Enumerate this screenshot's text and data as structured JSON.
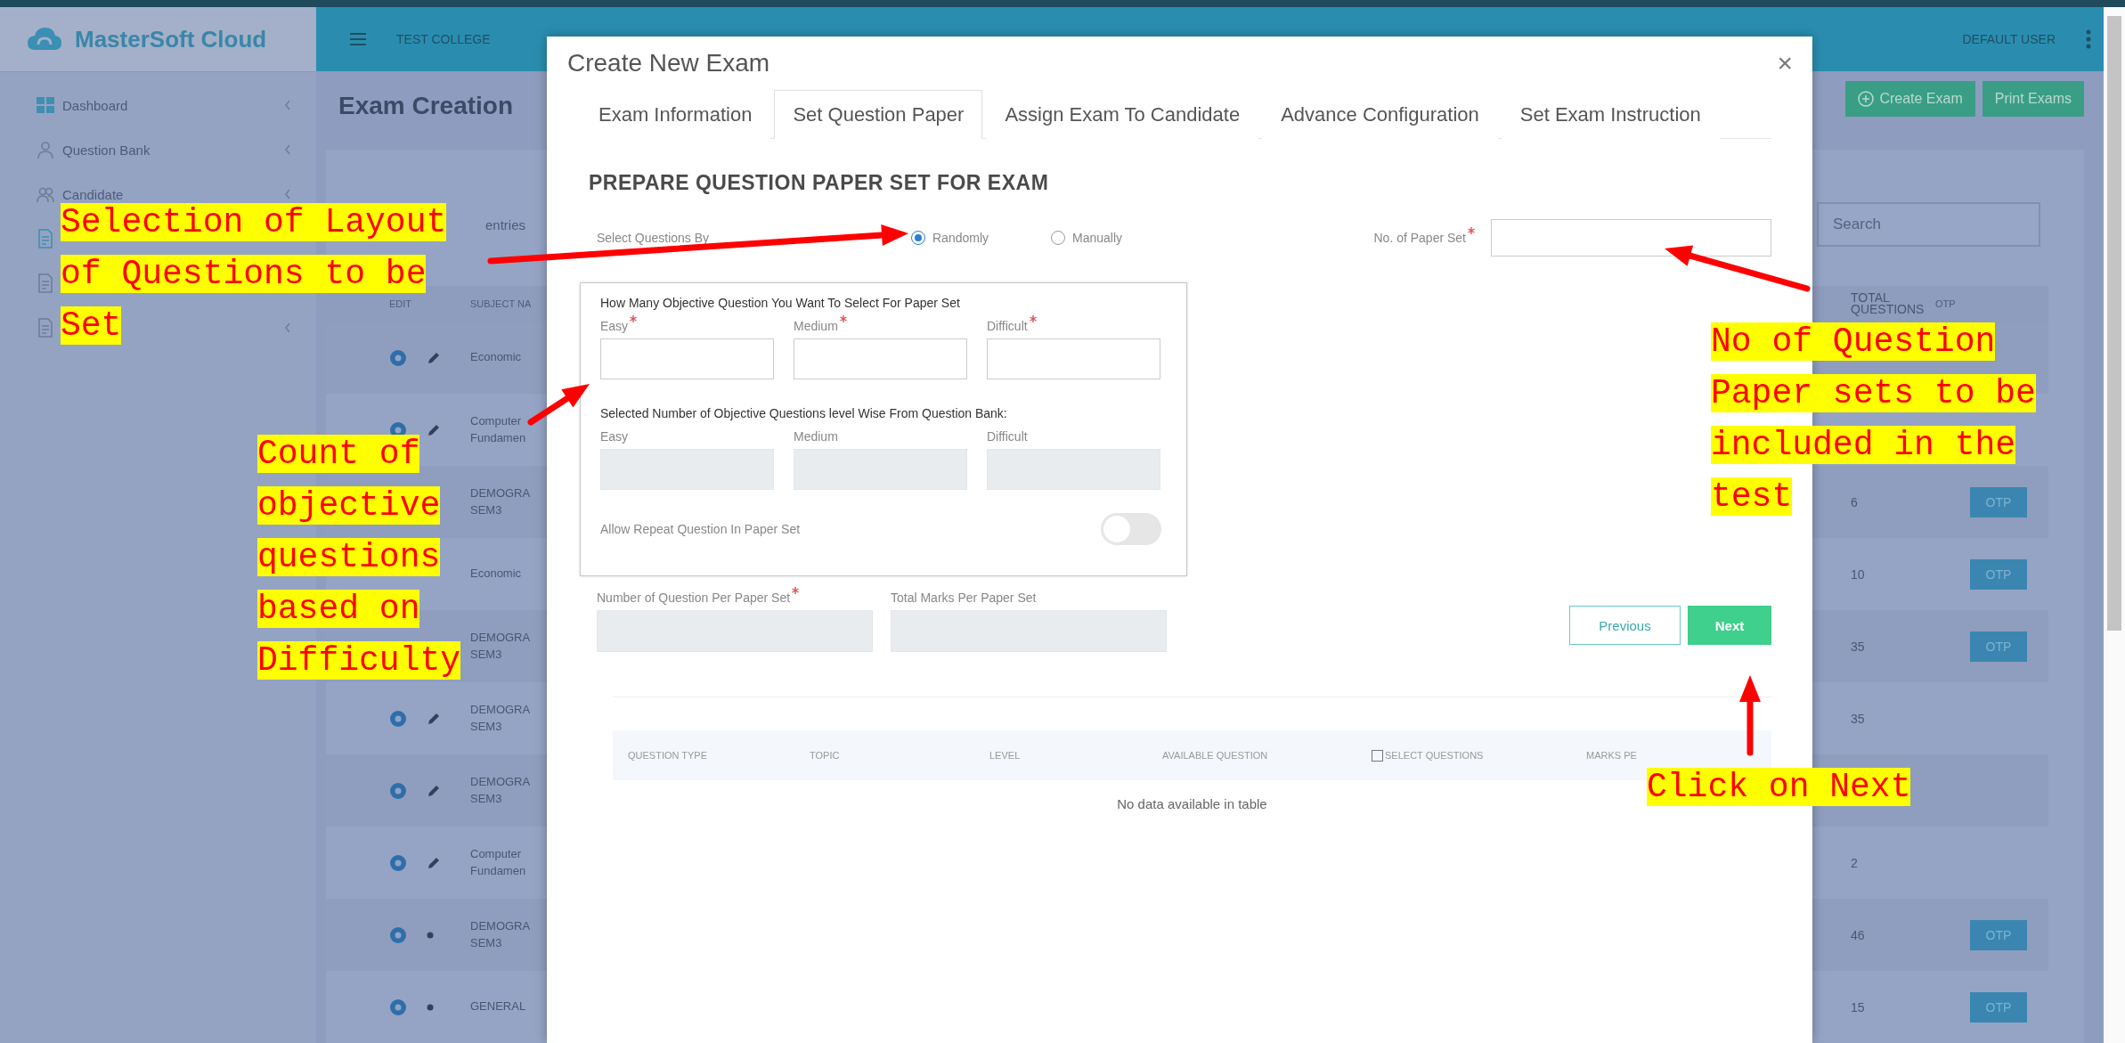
{
  "app": {
    "logo": "MasterSoft Cloud",
    "college": "TEST COLLEGE",
    "user": "DEFAULT USER"
  },
  "sidebar": {
    "items": [
      {
        "kind": "dashboard",
        "label": "Dashboard",
        "expandable": true
      },
      {
        "kind": "question-bank",
        "label": "Question Bank",
        "expandable": true
      },
      {
        "kind": "candidate",
        "label": "Candidate",
        "expandable": true
      },
      {
        "kind": "exam"
      },
      {
        "kind": "report"
      },
      {
        "kind": "panel",
        "expandable": true
      }
    ]
  },
  "page": {
    "title": "Exam Creation",
    "buttons": [
      {
        "kind": "create",
        "label": "Create Exam"
      },
      {
        "kind": "print",
        "label": "Print Exams"
      }
    ],
    "length_label": "entries",
    "search": {
      "placeholder": "Search"
    },
    "table": {
      "columns": [
        "EDIT",
        "SUBJECT NA",
        "TOTAL QUESTIONS",
        "OTP"
      ],
      "rows": [
        {
          "kind": "pencil",
          "subject": "Economic"
        },
        {
          "kind": "pencil",
          "subject": "Computer Fundamen"
        },
        {
          "subject": "DEMOGRA SEM3",
          "total": "6",
          "otp": "OTP"
        },
        {
          "subject": "Economic",
          "total": "10",
          "otp": "OTP"
        },
        {
          "subject": "DEMOGRA SEM3",
          "total": "35",
          "otp": "OTP"
        },
        {
          "kind": "pencil",
          "subject": "DEMOGRA SEM3",
          "total": "35"
        },
        {
          "kind": "pencil",
          "subject": "DEMOGRA SEM3"
        },
        {
          "kind": "pencil",
          "subject": "Computer Fundamen",
          "total": "2"
        },
        {
          "kind": "dot",
          "subject": "DEMOGRA SEM3",
          "total": "46",
          "otp": "OTP"
        },
        {
          "kind": "dot",
          "subject": "GENERAL",
          "total": "15",
          "otp": "OTP"
        }
      ]
    }
  },
  "modal": {
    "title": "Create New Exam",
    "close": "×",
    "tabs": [
      {
        "label": "Exam Information",
        "selected": false
      },
      {
        "label": "Set Question Paper",
        "selected": true
      },
      {
        "label": "Assign Exam To Candidate",
        "selected": false
      },
      {
        "label": "Advance Configuration",
        "selected": false
      },
      {
        "label": "Set Exam Instruction",
        "selected": false
      }
    ],
    "heading": "PREPARE QUESTION PAPER SET FOR EXAM",
    "select_by": {
      "label": "Select Questions By",
      "options": [
        {
          "label": "Randomly",
          "selected": true
        },
        {
          "label": "Manually",
          "selected": false
        }
      ]
    },
    "paper_sets": {
      "label": "No. of Paper Set",
      "required": true
    },
    "objective_box": {
      "title": "How Many Objective Question You Want To Select For Paper Set",
      "fields": [
        {
          "label": "Easy",
          "required": true,
          "disabled": false
        },
        {
          "label": "Medium",
          "required": true,
          "disabled": false
        },
        {
          "label": "Difficult",
          "required": true,
          "disabled": false
        }
      ],
      "bank_title": "Selected Number of Objective Questions level Wise From Question Bank:",
      "bank_fields": [
        {
          "label": "Easy",
          "required": false,
          "disabled": true
        },
        {
          "label": "Medium",
          "required": false,
          "disabled": true
        },
        {
          "label": "Difficult",
          "required": false,
          "disabled": true
        }
      ],
      "repeat": {
        "label": "Allow Repeat Question In Paper Set",
        "on": false
      }
    },
    "totals": [
      {
        "label": "Number of Question Per Paper Set",
        "required": true,
        "disabled": true
      },
      {
        "label": "Total Marks Per Paper Set",
        "required": false,
        "disabled": true
      }
    ],
    "buttons": [
      {
        "kind": "secondary",
        "label": "Previous"
      },
      {
        "kind": "primary",
        "label": "Next"
      }
    ],
    "question_table": {
      "columns": [
        {
          "label": "QUESTION TYPE"
        },
        {
          "label": "TOPIC"
        },
        {
          "label": "LEVEL"
        },
        {
          "label": "AVAILABLE QUESTION"
        },
        {
          "label": "SELECT QUESTIONS",
          "checkbox": true,
          "checked": false
        },
        {
          "label": "MARKS PE"
        }
      ],
      "empty_text": "No data available in table"
    }
  },
  "annotations": [
    {
      "text": "Selection of Layout of Questions to be Set"
    },
    {
      "text": "Count of objective questions based on Difficulty"
    },
    {
      "text": "No of Question Paper sets to be included in the test"
    },
    {
      "text": "Click on Next"
    }
  ]
}
